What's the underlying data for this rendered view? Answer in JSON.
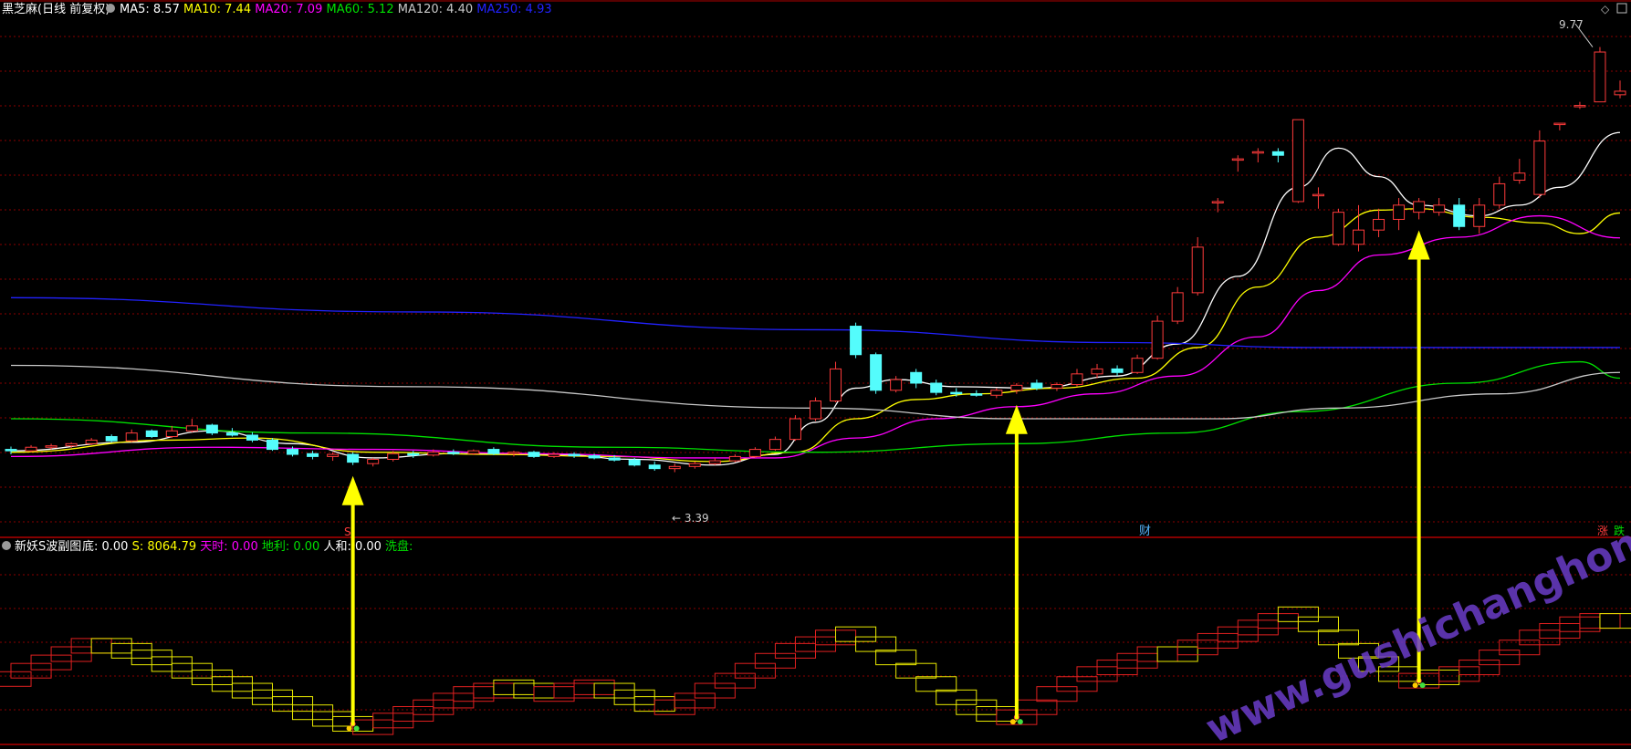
{
  "colors": {
    "up": "#ff3b3b",
    "down": "#54fcfc",
    "ma5": "#ffffff",
    "ma10": "#ffff00",
    "ma20": "#ff00ff",
    "ma60": "#00e000",
    "ma120": "#c8c8c8",
    "ma250": "#2222ff",
    "grid": "#8a0000",
    "frame": "#b00000",
    "arrow": "#ffff00",
    "wave_red": "#e02020",
    "wave_yellow": "#e8e800",
    "watermark": "#6a3cc8"
  },
  "header": {
    "title": "黑芝麻(日线 前复权)",
    "items": [
      {
        "label": "MA5: 8.57",
        "color": "#ffffff"
      },
      {
        "label": "MA10: 7.44",
        "color": "#ffff00"
      },
      {
        "label": "MA20: 7.09",
        "color": "#ff00ff"
      },
      {
        "label": "MA60: 5.12",
        "color": "#00e000"
      },
      {
        "label": "MA120: 4.40",
        "color": "#c8c8c8"
      },
      {
        "label": "MA250: 4.93",
        "color": "#2222ff"
      }
    ]
  },
  "sub_header": {
    "title": "新妖S波副图",
    "items": [
      {
        "label": "底: 0.00",
        "color": "#ffffff"
      },
      {
        "label": "S: 8064.79",
        "color": "#ffff00"
      },
      {
        "label": "天时: 0.00",
        "color": "#ff00ff"
      },
      {
        "label": "地利: 0.00",
        "color": "#00e000"
      },
      {
        "label": "人和: 0.00",
        "color": "#ffffff"
      },
      {
        "label": "洗盘:",
        "color": "#00e000"
      }
    ]
  },
  "annotations": {
    "high_label": "9.77",
    "low_label": "← 3.39",
    "s_marker": "S",
    "cai_marker": "财",
    "zhang_marker": "涨",
    "die_marker": "跌"
  },
  "watermark": "www.gushichanghong.com",
  "chart_data": {
    "type": "candlestick",
    "title": "黑芝麻(日线 前复权)",
    "candles": [
      [
        4.12,
        4.16,
        4.05,
        4.1
      ],
      [
        4.1,
        4.18,
        4.08,
        4.15
      ],
      [
        4.15,
        4.2,
        4.12,
        4.17
      ],
      [
        4.17,
        4.22,
        4.14,
        4.2
      ],
      [
        4.2,
        4.28,
        4.18,
        4.25
      ],
      [
        4.3,
        4.33,
        4.22,
        4.24
      ],
      [
        4.24,
        4.4,
        4.22,
        4.35
      ],
      [
        4.38,
        4.4,
        4.28,
        4.3
      ],
      [
        4.3,
        4.45,
        4.28,
        4.38
      ],
      [
        4.38,
        4.55,
        4.36,
        4.45
      ],
      [
        4.46,
        4.48,
        4.32,
        4.35
      ],
      [
        4.35,
        4.42,
        4.3,
        4.32
      ],
      [
        4.32,
        4.36,
        4.22,
        4.25
      ],
      [
        4.25,
        4.28,
        4.1,
        4.12
      ],
      [
        4.12,
        4.16,
        4.02,
        4.05
      ],
      [
        4.06,
        4.1,
        3.98,
        4.02
      ],
      [
        4.02,
        4.08,
        3.96,
        4.05
      ],
      [
        4.05,
        4.08,
        3.9,
        3.94
      ],
      [
        3.92,
        4.0,
        3.88,
        3.98
      ],
      [
        3.98,
        4.1,
        3.95,
        4.06
      ],
      [
        4.06,
        4.1,
        4.0,
        4.04
      ],
      [
        4.04,
        4.12,
        4.02,
        4.08
      ],
      [
        4.08,
        4.12,
        4.04,
        4.06
      ],
      [
        4.06,
        4.12,
        4.04,
        4.1
      ],
      [
        4.12,
        4.15,
        4.04,
        4.06
      ],
      [
        4.06,
        4.1,
        4.02,
        4.08
      ],
      [
        4.08,
        4.1,
        4.0,
        4.02
      ],
      [
        4.02,
        4.08,
        4.0,
        4.05
      ],
      [
        4.05,
        4.08,
        4.0,
        4.03
      ],
      [
        4.03,
        4.06,
        3.98,
        4.0
      ],
      [
        4.0,
        4.04,
        3.95,
        3.97
      ],
      [
        3.97,
        4.0,
        3.88,
        3.9
      ],
      [
        3.9,
        3.95,
        3.82,
        3.85
      ],
      [
        3.85,
        3.92,
        3.8,
        3.88
      ],
      [
        3.88,
        3.95,
        3.85,
        3.92
      ],
      [
        3.92,
        4.0,
        3.9,
        3.96
      ],
      [
        3.96,
        4.05,
        3.94,
        4.02
      ],
      [
        4.02,
        4.15,
        4.0,
        4.12
      ],
      [
        4.12,
        4.3,
        4.1,
        4.26
      ],
      [
        4.26,
        4.6,
        4.24,
        4.55
      ],
      [
        4.55,
        4.85,
        4.52,
        4.8
      ],
      [
        4.8,
        5.35,
        4.78,
        5.25
      ],
      [
        5.85,
        5.9,
        5.4,
        5.45
      ],
      [
        5.45,
        5.48,
        4.9,
        4.95
      ],
      [
        4.95,
        5.15,
        4.92,
        5.1
      ],
      [
        5.2,
        5.25,
        4.98,
        5.05
      ],
      [
        5.05,
        5.1,
        4.88,
        4.92
      ],
      [
        4.92,
        4.98,
        4.86,
        4.9
      ],
      [
        4.9,
        4.95,
        4.86,
        4.88
      ],
      [
        4.88,
        4.98,
        4.84,
        4.95
      ],
      [
        4.95,
        5.05,
        4.9,
        5.02
      ],
      [
        5.05,
        5.1,
        4.95,
        4.98
      ],
      [
        4.98,
        5.06,
        4.94,
        5.03
      ],
      [
        5.03,
        5.25,
        5.0,
        5.18
      ],
      [
        5.18,
        5.32,
        5.12,
        5.25
      ],
      [
        5.25,
        5.3,
        5.15,
        5.2
      ],
      [
        5.2,
        5.45,
        5.18,
        5.4
      ],
      [
        5.4,
        6.0,
        5.38,
        5.92
      ],
      [
        5.92,
        6.4,
        5.88,
        6.32
      ],
      [
        6.32,
        7.1,
        6.28,
        6.96
      ],
      [
        7.6,
        7.65,
        7.45,
        7.6
      ],
      [
        8.2,
        8.25,
        8.02,
        8.2
      ],
      [
        8.3,
        8.35,
        8.15,
        8.3
      ],
      [
        8.3,
        8.35,
        8.15,
        8.25
      ],
      [
        7.6,
        8.75,
        7.58,
        8.75
      ],
      [
        7.7,
        7.8,
        7.5,
        7.7
      ],
      [
        7.0,
        7.5,
        6.98,
        7.45
      ],
      [
        7.0,
        7.55,
        6.9,
        7.2
      ],
      [
        7.2,
        7.5,
        7.1,
        7.35
      ],
      [
        7.35,
        7.65,
        7.2,
        7.55
      ],
      [
        7.45,
        7.65,
        7.35,
        7.6
      ],
      [
        7.45,
        7.65,
        7.4,
        7.55
      ],
      [
        7.55,
        7.65,
        7.2,
        7.25
      ],
      [
        7.25,
        7.65,
        7.15,
        7.55
      ],
      [
        7.55,
        7.95,
        7.5,
        7.85
      ],
      [
        7.9,
        8.2,
        7.85,
        8.0
      ],
      [
        7.7,
        8.6,
        7.65,
        8.45
      ],
      [
        8.7,
        8.7,
        8.6,
        8.7
      ],
      [
        8.95,
        9.0,
        8.9,
        8.95
      ],
      [
        9.0,
        9.77,
        9.0,
        9.7
      ],
      [
        9.1,
        9.3,
        9.05,
        9.15
      ]
    ],
    "indices": [
      0,
      1,
      2,
      3,
      4,
      5,
      6,
      7,
      8,
      9,
      10,
      11,
      12,
      13,
      14,
      15,
      16,
      17,
      18,
      19,
      20,
      21,
      22,
      23,
      24,
      25,
      26,
      27,
      28,
      29,
      30,
      31,
      32,
      33,
      34,
      35,
      36,
      37,
      38,
      39,
      40,
      41,
      42,
      43,
      44,
      45,
      46,
      47,
      48,
      49,
      50,
      51,
      52,
      53,
      54,
      55,
      56,
      57,
      58,
      59,
      60,
      61,
      62,
      63,
      64,
      65,
      66,
      67,
      68,
      69,
      70,
      71,
      72,
      73,
      74,
      75,
      76,
      77,
      78,
      79,
      80
    ],
    "ma_series": [
      {
        "name": "MA5",
        "values": [
          [
            0,
            4.1
          ],
          [
            6,
            4.22
          ],
          [
            10,
            4.38
          ],
          [
            14,
            4.2
          ],
          [
            18,
            4.0
          ],
          [
            22,
            4.06
          ],
          [
            27,
            4.05
          ],
          [
            31,
            3.98
          ],
          [
            35,
            3.9
          ],
          [
            38,
            4.05
          ],
          [
            40,
            4.5
          ],
          [
            42,
            4.98
          ],
          [
            44,
            5.1
          ],
          [
            47,
            5.0
          ],
          [
            51,
            4.98
          ],
          [
            55,
            5.15
          ],
          [
            58,
            5.6
          ],
          [
            61,
            6.55
          ],
          [
            64,
            7.8
          ],
          [
            66,
            8.35
          ],
          [
            68,
            7.95
          ],
          [
            70,
            7.55
          ],
          [
            73,
            7.4
          ],
          [
            75,
            7.55
          ],
          [
            77,
            7.8
          ],
          [
            80,
            8.57
          ]
        ]
      },
      {
        "name": "MA10",
        "values": [
          [
            0,
            4.08
          ],
          [
            8,
            4.25
          ],
          [
            12,
            4.28
          ],
          [
            18,
            4.08
          ],
          [
            24,
            4.05
          ],
          [
            30,
            4.02
          ],
          [
            35,
            3.95
          ],
          [
            39,
            4.08
          ],
          [
            42,
            4.55
          ],
          [
            45,
            4.82
          ],
          [
            48,
            4.9
          ],
          [
            52,
            4.98
          ],
          [
            56,
            5.12
          ],
          [
            59,
            5.55
          ],
          [
            62,
            6.4
          ],
          [
            65,
            7.1
          ],
          [
            68,
            7.48
          ],
          [
            70,
            7.5
          ],
          [
            73,
            7.38
          ],
          [
            76,
            7.3
          ],
          [
            78,
            7.15
          ],
          [
            80,
            7.44
          ]
        ]
      },
      {
        "name": "MA20",
        "values": [
          [
            0,
            4.02
          ],
          [
            10,
            4.15
          ],
          [
            18,
            4.12
          ],
          [
            26,
            4.06
          ],
          [
            34,
            4.0
          ],
          [
            38,
            4.0
          ],
          [
            42,
            4.28
          ],
          [
            46,
            4.55
          ],
          [
            50,
            4.72
          ],
          [
            54,
            4.9
          ],
          [
            58,
            5.15
          ],
          [
            62,
            5.7
          ],
          [
            65,
            6.35
          ],
          [
            68,
            6.85
          ],
          [
            72,
            7.1
          ],
          [
            76,
            7.4
          ],
          [
            80,
            7.09
          ]
        ]
      },
      {
        "name": "MA60",
        "values": [
          [
            0,
            4.55
          ],
          [
            15,
            4.35
          ],
          [
            30,
            4.15
          ],
          [
            40,
            4.08
          ],
          [
            50,
            4.2
          ],
          [
            58,
            4.35
          ],
          [
            64,
            4.65
          ],
          [
            72,
            5.05
          ],
          [
            78,
            5.35
          ],
          [
            80,
            5.12
          ]
        ]
      },
      {
        "name": "MA120",
        "values": [
          [
            0,
            5.3
          ],
          [
            20,
            5.0
          ],
          [
            40,
            4.7
          ],
          [
            50,
            4.55
          ],
          [
            60,
            4.55
          ],
          [
            66,
            4.7
          ],
          [
            74,
            4.9
          ],
          [
            80,
            5.2
          ]
        ]
      },
      {
        "name": "MA250",
        "values": [
          [
            0,
            6.25
          ],
          [
            20,
            6.05
          ],
          [
            40,
            5.8
          ],
          [
            55,
            5.62
          ],
          [
            65,
            5.55
          ],
          [
            80,
            5.55
          ]
        ]
      }
    ],
    "ylim": [
      3.0,
      10.2
    ],
    "high": 9.77,
    "low": 3.39
  },
  "sub_chart_data": {
    "type": "step-area",
    "ylim": [
      0,
      100
    ],
    "steps": [
      [
        0,
        0,
        35,
        0
      ],
      [
        1,
        1,
        40,
        0
      ],
      [
        2,
        2,
        45,
        0
      ],
      [
        3,
        3,
        50,
        0
      ],
      [
        4,
        4,
        55,
        0
      ],
      [
        5,
        5,
        55,
        1
      ],
      [
        6,
        6,
        52,
        1
      ],
      [
        7,
        7,
        48,
        1
      ],
      [
        8,
        8,
        44,
        1
      ],
      [
        9,
        9,
        40,
        1
      ],
      [
        10,
        10,
        36,
        1
      ],
      [
        11,
        11,
        32,
        1
      ],
      [
        12,
        12,
        28,
        1
      ],
      [
        13,
        13,
        24,
        1
      ],
      [
        14,
        14,
        20,
        1
      ],
      [
        15,
        15,
        15,
        1
      ],
      [
        16,
        16,
        11,
        1
      ],
      [
        17,
        17,
        8,
        1
      ],
      [
        18,
        18,
        6,
        0
      ],
      [
        19,
        19,
        10,
        0
      ],
      [
        20,
        20,
        14,
        0
      ],
      [
        21,
        21,
        18,
        0
      ],
      [
        22,
        22,
        22,
        0
      ],
      [
        23,
        23,
        26,
        0
      ],
      [
        24,
        24,
        28,
        0
      ],
      [
        25,
        25,
        30,
        1
      ],
      [
        26,
        26,
        28,
        1
      ],
      [
        27,
        27,
        26,
        0
      ],
      [
        28,
        28,
        28,
        0
      ],
      [
        29,
        29,
        30,
        0
      ],
      [
        30,
        30,
        28,
        1
      ],
      [
        31,
        31,
        24,
        1
      ],
      [
        32,
        32,
        20,
        1
      ],
      [
        33,
        33,
        18,
        0
      ],
      [
        34,
        34,
        22,
        0
      ],
      [
        35,
        35,
        28,
        0
      ],
      [
        36,
        36,
        34,
        0
      ],
      [
        37,
        37,
        40,
        0
      ],
      [
        38,
        38,
        46,
        0
      ],
      [
        39,
        39,
        52,
        0
      ],
      [
        40,
        40,
        56,
        0
      ],
      [
        41,
        41,
        60,
        0
      ],
      [
        42,
        42,
        62,
        1
      ],
      [
        43,
        43,
        56,
        1
      ],
      [
        44,
        44,
        48,
        1
      ],
      [
        45,
        45,
        40,
        1
      ],
      [
        46,
        46,
        32,
        1
      ],
      [
        47,
        47,
        24,
        1
      ],
      [
        48,
        48,
        18,
        1
      ],
      [
        49,
        49,
        14,
        1
      ],
      [
        50,
        50,
        12,
        0
      ],
      [
        51,
        51,
        18,
        0
      ],
      [
        52,
        52,
        26,
        0
      ],
      [
        53,
        53,
        32,
        0
      ],
      [
        54,
        54,
        38,
        0
      ],
      [
        55,
        55,
        42,
        0
      ],
      [
        56,
        56,
        46,
        0
      ],
      [
        57,
        57,
        50,
        0
      ],
      [
        58,
        58,
        50,
        1
      ],
      [
        59,
        59,
        54,
        0
      ],
      [
        60,
        60,
        58,
        0
      ],
      [
        61,
        61,
        62,
        0
      ],
      [
        62,
        62,
        66,
        0
      ],
      [
        63,
        63,
        70,
        0
      ],
      [
        64,
        64,
        74,
        1
      ],
      [
        65,
        65,
        68,
        1
      ],
      [
        66,
        66,
        60,
        1
      ],
      [
        67,
        67,
        52,
        1
      ],
      [
        68,
        68,
        44,
        1
      ],
      [
        69,
        69,
        38,
        1
      ],
      [
        70,
        70,
        34,
        0
      ],
      [
        71,
        71,
        36,
        1
      ],
      [
        72,
        72,
        38,
        0
      ],
      [
        73,
        73,
        42,
        0
      ],
      [
        74,
        74,
        48,
        0
      ],
      [
        75,
        75,
        54,
        0
      ],
      [
        76,
        76,
        60,
        0
      ],
      [
        77,
        77,
        64,
        0
      ],
      [
        78,
        78,
        68,
        0
      ],
      [
        79,
        79,
        70,
        0
      ],
      [
        80,
        80,
        70,
        1
      ]
    ],
    "signal_indices": [
      17,
      50,
      70
    ]
  }
}
